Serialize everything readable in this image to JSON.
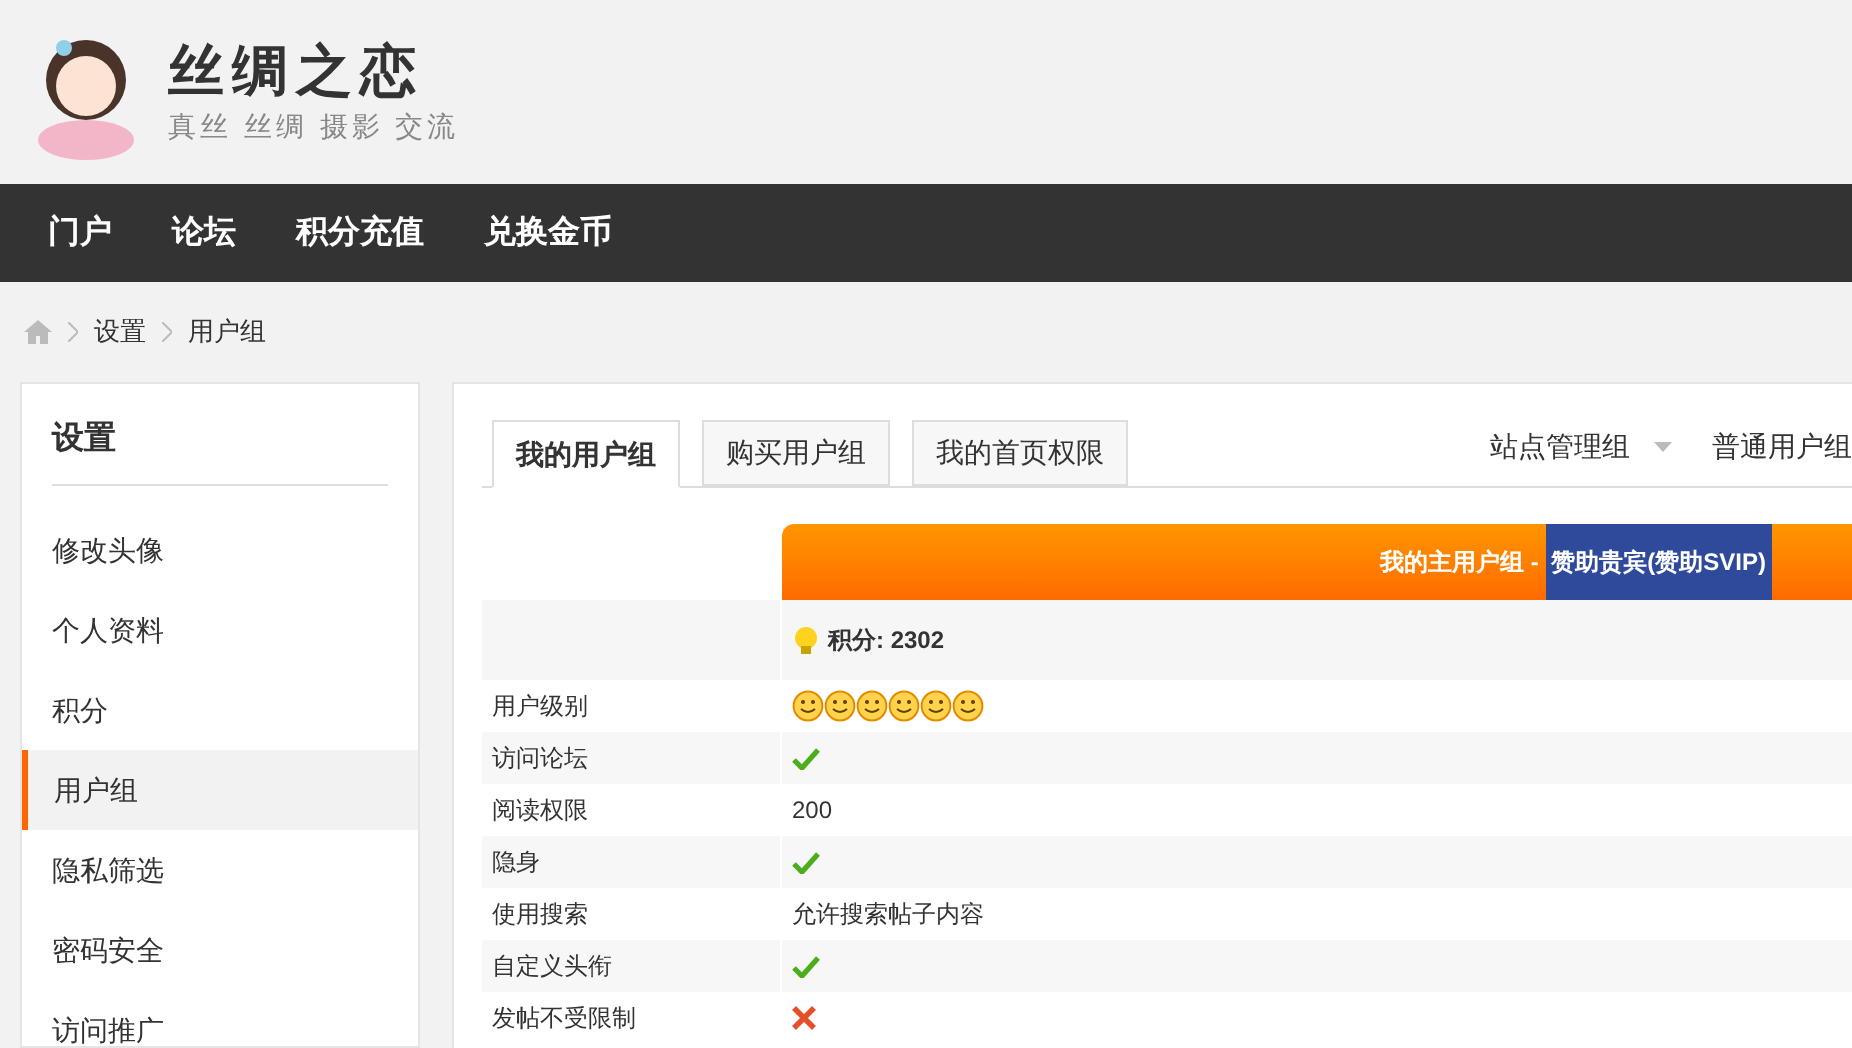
{
  "site": {
    "title": "丝绸之恋",
    "subtitle": "真丝 丝绸 摄影 交流"
  },
  "nav": [
    {
      "label": "门户"
    },
    {
      "label": "论坛"
    },
    {
      "label": "积分充值"
    },
    {
      "label": "兑换金币"
    }
  ],
  "breadcrumb": [
    "设置",
    "用户组"
  ],
  "sidebar": {
    "title": "设置",
    "items": [
      {
        "label": "修改头像",
        "selected": false
      },
      {
        "label": "个人资料",
        "selected": false
      },
      {
        "label": "积分",
        "selected": false
      },
      {
        "label": "用户组",
        "selected": true
      },
      {
        "label": "隐私筛选",
        "selected": false
      },
      {
        "label": "密码安全",
        "selected": false
      },
      {
        "label": "访问推广",
        "selected": false
      }
    ]
  },
  "tabs": [
    {
      "label": "我的用户组",
      "selected": true
    },
    {
      "label": "购买用户组",
      "selected": false
    },
    {
      "label": "我的首页权限",
      "selected": false
    }
  ],
  "group_menus": [
    {
      "label": "站点管理组",
      "dropdown": true
    },
    {
      "label": "普通用户组",
      "dropdown": false
    }
  ],
  "group_header": {
    "prefix": "我的主用户组 - ",
    "group": "赞助贵宾(赞助SVIP)"
  },
  "credits": "积分: 2302",
  "rows": [
    {
      "label": "用户级别",
      "kind": "stars",
      "stars": 6
    },
    {
      "label": "访问论坛",
      "kind": "check"
    },
    {
      "label": "阅读权限",
      "kind": "text",
      "value": "200"
    },
    {
      "label": "隐身",
      "kind": "check"
    },
    {
      "label": "使用搜索",
      "kind": "text",
      "value": "允许搜索帖子内容"
    },
    {
      "label": "自定义头衔",
      "kind": "check"
    },
    {
      "label": "发帖不受限制",
      "kind": "cross"
    }
  ]
}
